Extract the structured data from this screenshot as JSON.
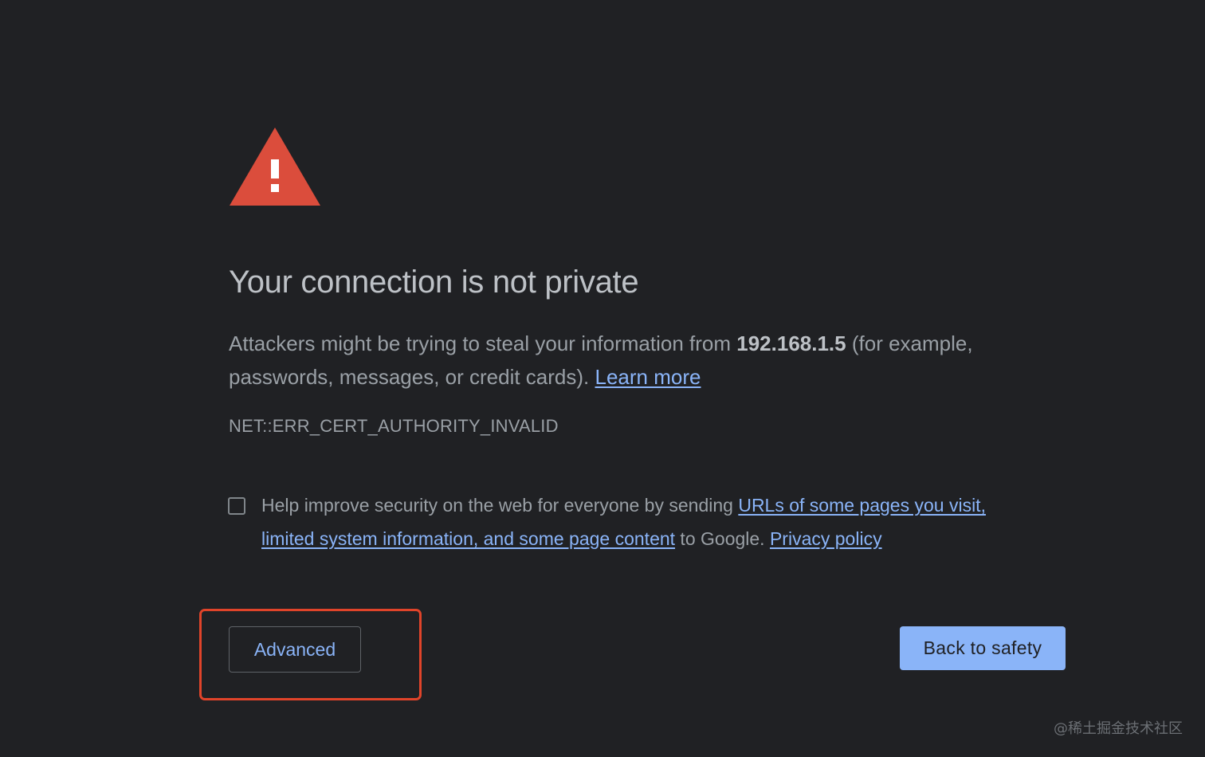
{
  "colors": {
    "background": "#202124",
    "warning_icon": "#db4d3c",
    "link": "#8ab4f8",
    "primary_button": "#8ab4f8",
    "highlight_frame": "#e0442a"
  },
  "icon": {
    "name": "warning-triangle-icon"
  },
  "title": "Your connection is not private",
  "explanation": {
    "before": "Attackers might be trying to steal your information from ",
    "host": "192.168.1.5",
    "after": " (for example, passwords, messages, or credit cards). ",
    "learn_more": "Learn more"
  },
  "error_code": "NET::ERR_CERT_AUTHORITY_INVALID",
  "optin": {
    "checked": false,
    "before": "Help improve security on the web for everyone by sending ",
    "link_details": "URLs of some pages you visit, limited system information, and some page content",
    "middle": " to Google. ",
    "privacy_policy": "Privacy policy"
  },
  "buttons": {
    "advanced": "Advanced",
    "back_to_safety": "Back to safety"
  },
  "watermark": "@稀土掘金技术社区"
}
